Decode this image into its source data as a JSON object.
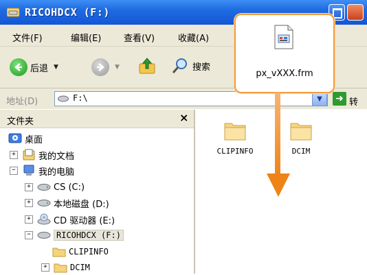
{
  "window": {
    "title": "RICOHDCX (F:)"
  },
  "menu": [
    "文件(F)",
    "编辑(E)",
    "查看(V)",
    "收藏(A)"
  ],
  "toolbar": {
    "back_label": "后退",
    "search_label": "搜索"
  },
  "address": {
    "label": "地址(D)",
    "value": "F:\\",
    "go_label": "转"
  },
  "folders_pane": {
    "title": "文件夹",
    "close": "×",
    "tree": [
      {
        "label": "桌面",
        "icon": "desktop-icon"
      },
      {
        "label": "我的文档",
        "icon": "my-documents-icon",
        "expander": "+"
      },
      {
        "label": "我的电脑",
        "icon": "my-computer-icon",
        "expander": "−"
      },
      {
        "label": "CS (C:)",
        "icon": "drive-icon",
        "expander": "+"
      },
      {
        "label": "本地磁盘 (D:)",
        "icon": "drive-icon",
        "expander": "+"
      },
      {
        "label": "CD 驱动器 (E:)",
        "icon": "cd-drive-icon",
        "expander": "+"
      },
      {
        "label": "RICOHDCX (F:)",
        "icon": "removable-drive-icon",
        "expander": "−",
        "selected": true
      },
      {
        "label": "CLIPINFO",
        "icon": "folder-icon"
      },
      {
        "label": "DCIM",
        "icon": "folder-icon",
        "expander": "+"
      }
    ]
  },
  "content": {
    "items": [
      {
        "name": "CLIPINFO",
        "icon": "folder-icon"
      },
      {
        "name": "DCIM",
        "icon": "folder-icon"
      }
    ]
  },
  "callout": {
    "filename": "px_vXXX.frm",
    "icon": "frm-file-icon"
  },
  "colors": {
    "titlebar": "#1f6be0",
    "callout_border": "#f49c3c",
    "arrow": "#f08a1f"
  }
}
